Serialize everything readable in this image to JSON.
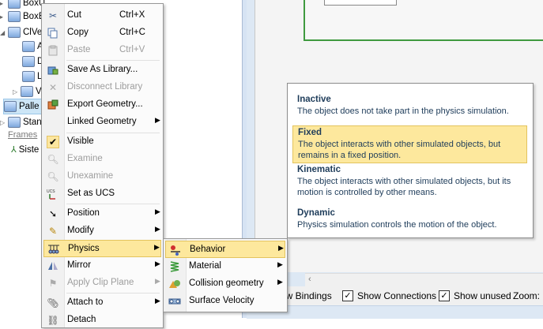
{
  "tree": {
    "items": [
      {
        "label": "BoxU"
      },
      {
        "label": "BoxB"
      },
      {
        "label": "ClVe"
      },
      {
        "label": "A"
      },
      {
        "label": "D"
      },
      {
        "label": "L"
      },
      {
        "label": "V"
      },
      {
        "label": "Palle"
      },
      {
        "label": "Stan"
      }
    ],
    "frames_label": "Frames",
    "sist_label": "Siste"
  },
  "context_menu": {
    "items": [
      {
        "id": "cut",
        "label": "Cut",
        "shortcut": "Ctrl+X",
        "icon": "scissors-icon",
        "enabled": true
      },
      {
        "id": "copy",
        "label": "Copy",
        "shortcut": "Ctrl+C",
        "icon": "copy-icon",
        "enabled": true
      },
      {
        "id": "paste",
        "label": "Paste",
        "shortcut": "Ctrl+V",
        "icon": "paste-icon",
        "enabled": false
      },
      {
        "id": "save_as_library",
        "label": "Save As Library...",
        "icon": "save-library-icon",
        "enabled": true
      },
      {
        "id": "disconnect_library",
        "label": "Disconnect Library",
        "icon": "disconnect-library-icon",
        "enabled": false
      },
      {
        "id": "export_geometry",
        "label": "Export Geometry...",
        "icon": "export-geometry-icon",
        "enabled": true
      },
      {
        "id": "linked_geometry",
        "label": "Linked Geometry",
        "icon": "",
        "enabled": true,
        "submenu": true
      },
      {
        "id": "visible",
        "label": "Visible",
        "icon": "checkmark-icon",
        "enabled": true,
        "checked": true
      },
      {
        "id": "examine",
        "label": "Examine",
        "icon": "examine-icon",
        "enabled": false
      },
      {
        "id": "unexamine",
        "label": "Unexamine",
        "icon": "unexamine-icon",
        "enabled": false
      },
      {
        "id": "set_as_ucs",
        "label": "Set as UCS",
        "icon": "ucs-icon",
        "enabled": true
      },
      {
        "id": "position",
        "label": "Position",
        "icon": "position-arrow-icon",
        "enabled": true,
        "submenu": true
      },
      {
        "id": "modify",
        "label": "Modify",
        "icon": "pencil-icon",
        "enabled": true,
        "submenu": true
      },
      {
        "id": "physics",
        "label": "Physics",
        "icon": "physics-icon",
        "enabled": true,
        "submenu": true,
        "highlighted": true
      },
      {
        "id": "mirror",
        "label": "Mirror",
        "icon": "mirror-icon",
        "enabled": true,
        "submenu": true
      },
      {
        "id": "apply_clip_plane",
        "label": "Apply Clip Plane",
        "icon": "clip-plane-icon",
        "enabled": false,
        "submenu": true
      },
      {
        "id": "attach_to",
        "label": "Attach to",
        "icon": "attach-icon",
        "enabled": true,
        "submenu": true
      },
      {
        "id": "detach",
        "label": "Detach",
        "icon": "detach-icon",
        "enabled": true
      }
    ]
  },
  "physics_submenu": {
    "items": [
      {
        "id": "behavior",
        "label": "Behavior",
        "icon": "behavior-icon",
        "submenu": true,
        "highlighted": true
      },
      {
        "id": "material",
        "label": "Material",
        "icon": "spring-icon",
        "submenu": true
      },
      {
        "id": "collision_geometry",
        "label": "Collision geometry",
        "icon": "collision-geometry-icon",
        "submenu": true
      },
      {
        "id": "surface_velocity",
        "label": "Surface Velocity",
        "icon": "surface-velocity-icon",
        "submenu": false
      }
    ]
  },
  "behavior_tooltip": {
    "options": [
      {
        "title": "Inactive",
        "desc": "The object does not take part in the physics simulation."
      },
      {
        "title": "Fixed",
        "desc": "The object interacts with other simulated objects, but remains in a fixed position.",
        "highlighted": true
      },
      {
        "title": "Kinematic",
        "desc": "The object interacts with other simulated objects, but its motion is controlled by other means."
      },
      {
        "title": "Dynamic",
        "desc": "Physics simulation controls the motion of the object."
      }
    ]
  },
  "bottom_bar": {
    "show_bindings": "ow Bindings",
    "show_connections": "Show Connections",
    "show_unused": "Show unused",
    "zoom_label": "Zoom:"
  },
  "colors": {
    "highlight": "#fde89d",
    "highlight_border": "#e3c35d",
    "tooltip_text": "#1e3c5a",
    "green_frame": "#3f9a3f"
  }
}
